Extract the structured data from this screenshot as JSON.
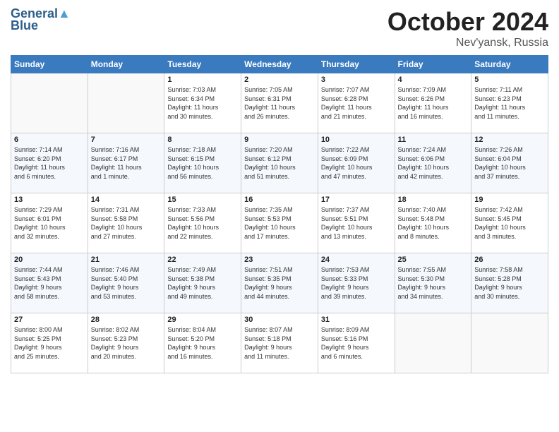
{
  "header": {
    "logo_line1": "General",
    "logo_line2": "Blue",
    "month": "October 2024",
    "location": "Nev'yansk, Russia"
  },
  "weekdays": [
    "Sunday",
    "Monday",
    "Tuesday",
    "Wednesday",
    "Thursday",
    "Friday",
    "Saturday"
  ],
  "weeks": [
    [
      {
        "day": "",
        "info": ""
      },
      {
        "day": "",
        "info": ""
      },
      {
        "day": "1",
        "info": "Sunrise: 7:03 AM\nSunset: 6:34 PM\nDaylight: 11 hours\nand 30 minutes."
      },
      {
        "day": "2",
        "info": "Sunrise: 7:05 AM\nSunset: 6:31 PM\nDaylight: 11 hours\nand 26 minutes."
      },
      {
        "day": "3",
        "info": "Sunrise: 7:07 AM\nSunset: 6:28 PM\nDaylight: 11 hours\nand 21 minutes."
      },
      {
        "day": "4",
        "info": "Sunrise: 7:09 AM\nSunset: 6:26 PM\nDaylight: 11 hours\nand 16 minutes."
      },
      {
        "day": "5",
        "info": "Sunrise: 7:11 AM\nSunset: 6:23 PM\nDaylight: 11 hours\nand 11 minutes."
      }
    ],
    [
      {
        "day": "6",
        "info": "Sunrise: 7:14 AM\nSunset: 6:20 PM\nDaylight: 11 hours\nand 6 minutes."
      },
      {
        "day": "7",
        "info": "Sunrise: 7:16 AM\nSunset: 6:17 PM\nDaylight: 11 hours\nand 1 minute."
      },
      {
        "day": "8",
        "info": "Sunrise: 7:18 AM\nSunset: 6:15 PM\nDaylight: 10 hours\nand 56 minutes."
      },
      {
        "day": "9",
        "info": "Sunrise: 7:20 AM\nSunset: 6:12 PM\nDaylight: 10 hours\nand 51 minutes."
      },
      {
        "day": "10",
        "info": "Sunrise: 7:22 AM\nSunset: 6:09 PM\nDaylight: 10 hours\nand 47 minutes."
      },
      {
        "day": "11",
        "info": "Sunrise: 7:24 AM\nSunset: 6:06 PM\nDaylight: 10 hours\nand 42 minutes."
      },
      {
        "day": "12",
        "info": "Sunrise: 7:26 AM\nSunset: 6:04 PM\nDaylight: 10 hours\nand 37 minutes."
      }
    ],
    [
      {
        "day": "13",
        "info": "Sunrise: 7:29 AM\nSunset: 6:01 PM\nDaylight: 10 hours\nand 32 minutes."
      },
      {
        "day": "14",
        "info": "Sunrise: 7:31 AM\nSunset: 5:58 PM\nDaylight: 10 hours\nand 27 minutes."
      },
      {
        "day": "15",
        "info": "Sunrise: 7:33 AM\nSunset: 5:56 PM\nDaylight: 10 hours\nand 22 minutes."
      },
      {
        "day": "16",
        "info": "Sunrise: 7:35 AM\nSunset: 5:53 PM\nDaylight: 10 hours\nand 17 minutes."
      },
      {
        "day": "17",
        "info": "Sunrise: 7:37 AM\nSunset: 5:51 PM\nDaylight: 10 hours\nand 13 minutes."
      },
      {
        "day": "18",
        "info": "Sunrise: 7:40 AM\nSunset: 5:48 PM\nDaylight: 10 hours\nand 8 minutes."
      },
      {
        "day": "19",
        "info": "Sunrise: 7:42 AM\nSunset: 5:45 PM\nDaylight: 10 hours\nand 3 minutes."
      }
    ],
    [
      {
        "day": "20",
        "info": "Sunrise: 7:44 AM\nSunset: 5:43 PM\nDaylight: 9 hours\nand 58 minutes."
      },
      {
        "day": "21",
        "info": "Sunrise: 7:46 AM\nSunset: 5:40 PM\nDaylight: 9 hours\nand 53 minutes."
      },
      {
        "day": "22",
        "info": "Sunrise: 7:49 AM\nSunset: 5:38 PM\nDaylight: 9 hours\nand 49 minutes."
      },
      {
        "day": "23",
        "info": "Sunrise: 7:51 AM\nSunset: 5:35 PM\nDaylight: 9 hours\nand 44 minutes."
      },
      {
        "day": "24",
        "info": "Sunrise: 7:53 AM\nSunset: 5:33 PM\nDaylight: 9 hours\nand 39 minutes."
      },
      {
        "day": "25",
        "info": "Sunrise: 7:55 AM\nSunset: 5:30 PM\nDaylight: 9 hours\nand 34 minutes."
      },
      {
        "day": "26",
        "info": "Sunrise: 7:58 AM\nSunset: 5:28 PM\nDaylight: 9 hours\nand 30 minutes."
      }
    ],
    [
      {
        "day": "27",
        "info": "Sunrise: 8:00 AM\nSunset: 5:25 PM\nDaylight: 9 hours\nand 25 minutes."
      },
      {
        "day": "28",
        "info": "Sunrise: 8:02 AM\nSunset: 5:23 PM\nDaylight: 9 hours\nand 20 minutes."
      },
      {
        "day": "29",
        "info": "Sunrise: 8:04 AM\nSunset: 5:20 PM\nDaylight: 9 hours\nand 16 minutes."
      },
      {
        "day": "30",
        "info": "Sunrise: 8:07 AM\nSunset: 5:18 PM\nDaylight: 9 hours\nand 11 minutes."
      },
      {
        "day": "31",
        "info": "Sunrise: 8:09 AM\nSunset: 5:16 PM\nDaylight: 9 hours\nand 6 minutes."
      },
      {
        "day": "",
        "info": ""
      },
      {
        "day": "",
        "info": ""
      }
    ]
  ]
}
